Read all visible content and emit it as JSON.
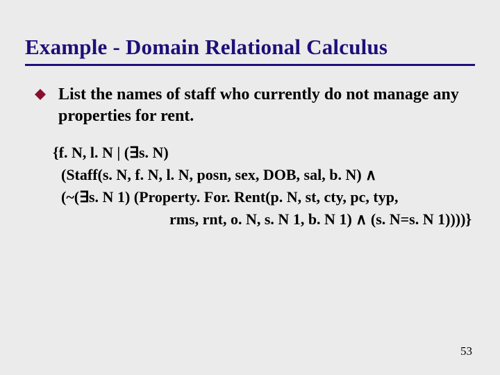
{
  "title": "Example - Domain Relational Calculus",
  "bullet": {
    "text": "List the names of staff who currently do not manage any properties for rent."
  },
  "expression": {
    "line1": "{f. N, l. N | (∃s. N)",
    "line2": "(Staff(s. N, f. N, l. N, posn, sex, DOB, sal, b. N) ∧",
    "line3": "(~(∃s. N 1) (Property. For. Rent(p. N, st, cty, pc, typ,",
    "line4": "rms, rnt, o. N, s. N 1, b. N 1) ∧ (s. N=s. N 1))))}"
  },
  "page_number": "53"
}
